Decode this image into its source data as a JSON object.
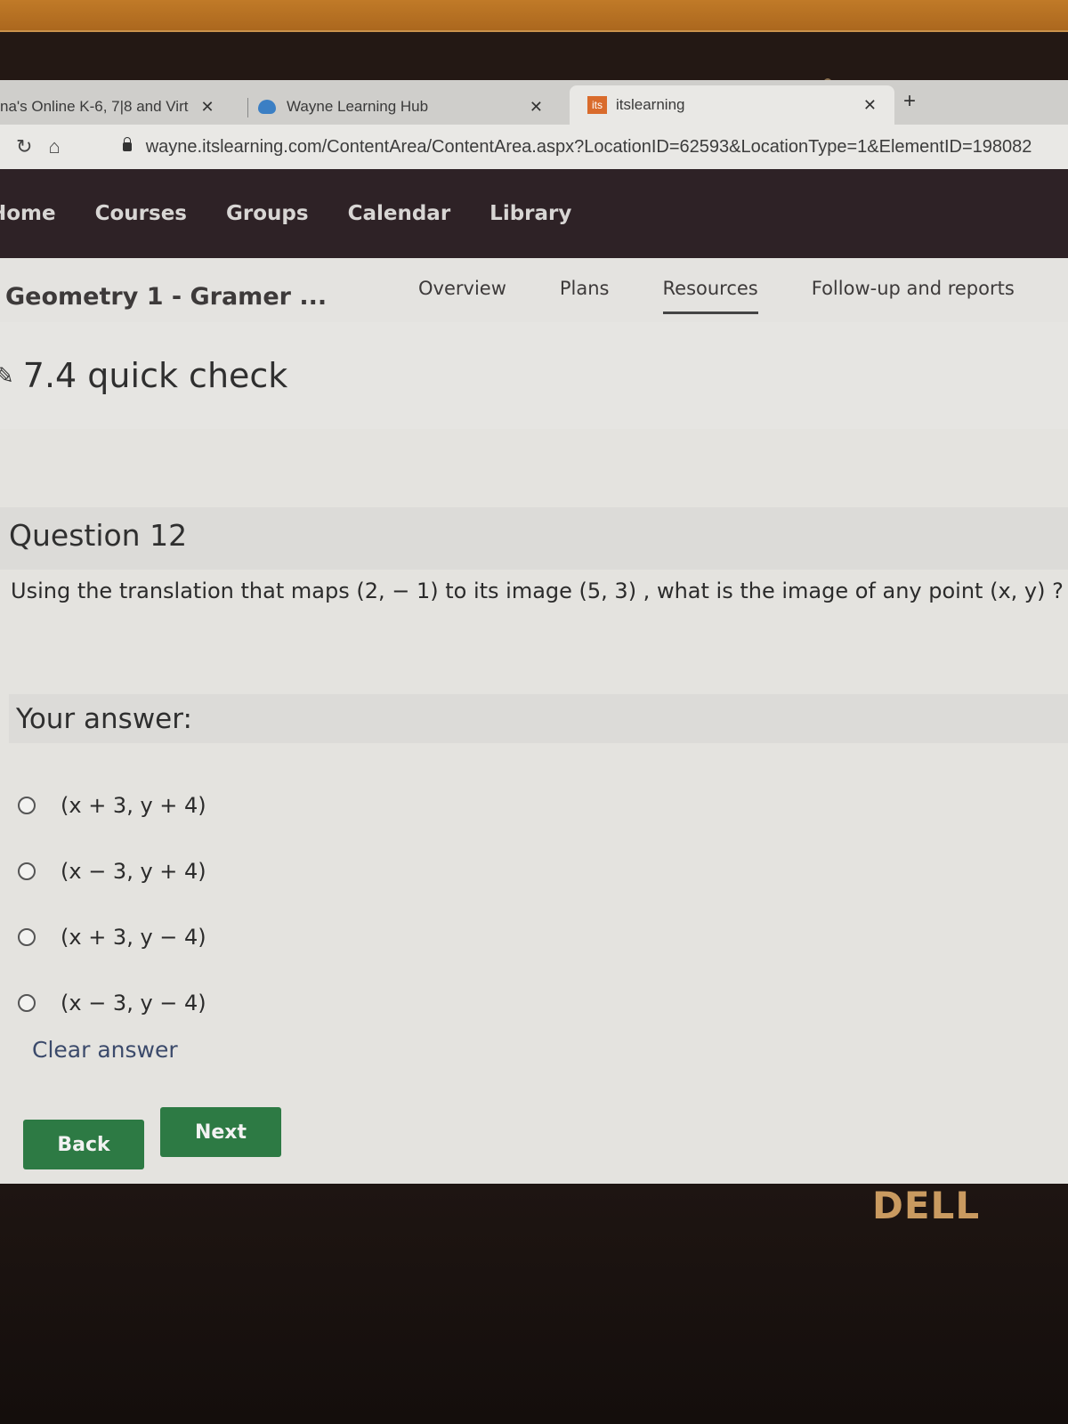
{
  "browser": {
    "tabs": [
      {
        "title": "na's Online K-6, 7|8 and Virt",
        "icon": "tab-favicon",
        "active": false
      },
      {
        "title": "Wayne Learning Hub",
        "icon": "cloud-icon",
        "active": false
      },
      {
        "title": "itslearning",
        "icon": "its-icon",
        "favicon_text": "its",
        "active": true
      }
    ],
    "close_glyph": "✕",
    "new_tab_glyph": "+",
    "reload_glyph": "↻",
    "home_glyph": "⌂",
    "url": "wayne.itslearning.com/ContentArea/ContentArea.aspx?LocationID=62593&LocationType=1&ElementID=198082"
  },
  "main_nav": {
    "items": [
      "Home",
      "Courses",
      "Groups",
      "Calendar",
      "Library"
    ]
  },
  "course": {
    "title": "Geometry 1 - Gramer ...",
    "tabs": [
      {
        "label": "Overview",
        "active": false
      },
      {
        "label": "Plans",
        "active": false
      },
      {
        "label": "Resources",
        "active": true
      },
      {
        "label": "Follow-up and reports",
        "active": false
      }
    ]
  },
  "page": {
    "edit_glyph": "✎",
    "title": "7.4 quick check"
  },
  "question": {
    "heading": "Question 12",
    "text": "Using the translation that maps (2, − 1) to its image (5, 3) , what is the image of any point (x, y) ?",
    "answer_heading": "Your answer:",
    "options": [
      "(x + 3, y + 4)",
      "(x − 3, y + 4)",
      "(x + 3, y − 4)",
      "(x − 3, y − 4)"
    ],
    "selected": null,
    "clear_label": "Clear answer",
    "back_label": "Back",
    "next_label": "Next"
  },
  "device": {
    "brand": "DELL"
  },
  "colors": {
    "nav_bg": "#2e2226",
    "button_green": "#2d7a44",
    "its_orange": "#d96b2c",
    "link_blue": "#3b4a6b"
  }
}
